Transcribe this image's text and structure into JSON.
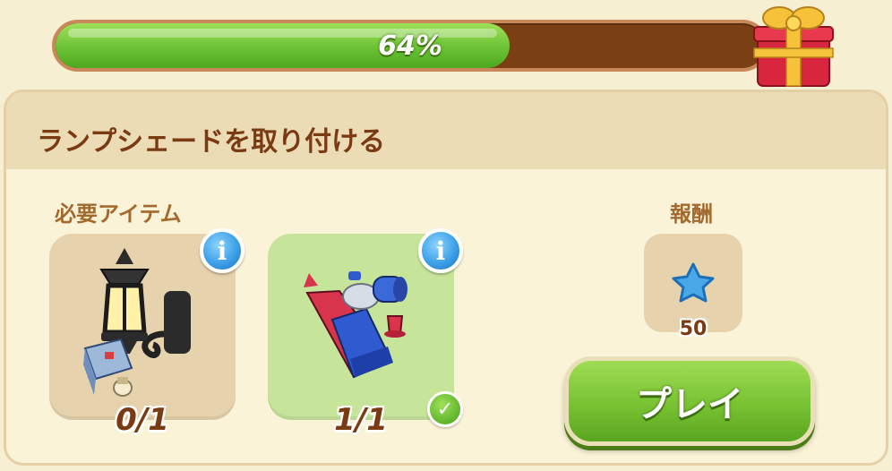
{
  "progress": {
    "percent_label": "64%",
    "value": 0.64
  },
  "task": {
    "title": "ランプシェードを取り付ける"
  },
  "required": {
    "label": "必要アイテム",
    "items": [
      {
        "icon": "street-lamp-icon",
        "count": "0/1",
        "complete": false
      },
      {
        "icon": "paint-tube-icon",
        "count": "1/1",
        "complete": true
      }
    ],
    "info_glyph": "i",
    "check_glyph": "✓"
  },
  "reward": {
    "label": "報酬",
    "icon": "blue-star-icon",
    "amount": "50"
  },
  "play_button": {
    "label": "プレイ"
  },
  "colors": {
    "progress_fill": "#6cc234",
    "progress_track": "#7a3f12",
    "accent_text": "#7a3b12"
  }
}
